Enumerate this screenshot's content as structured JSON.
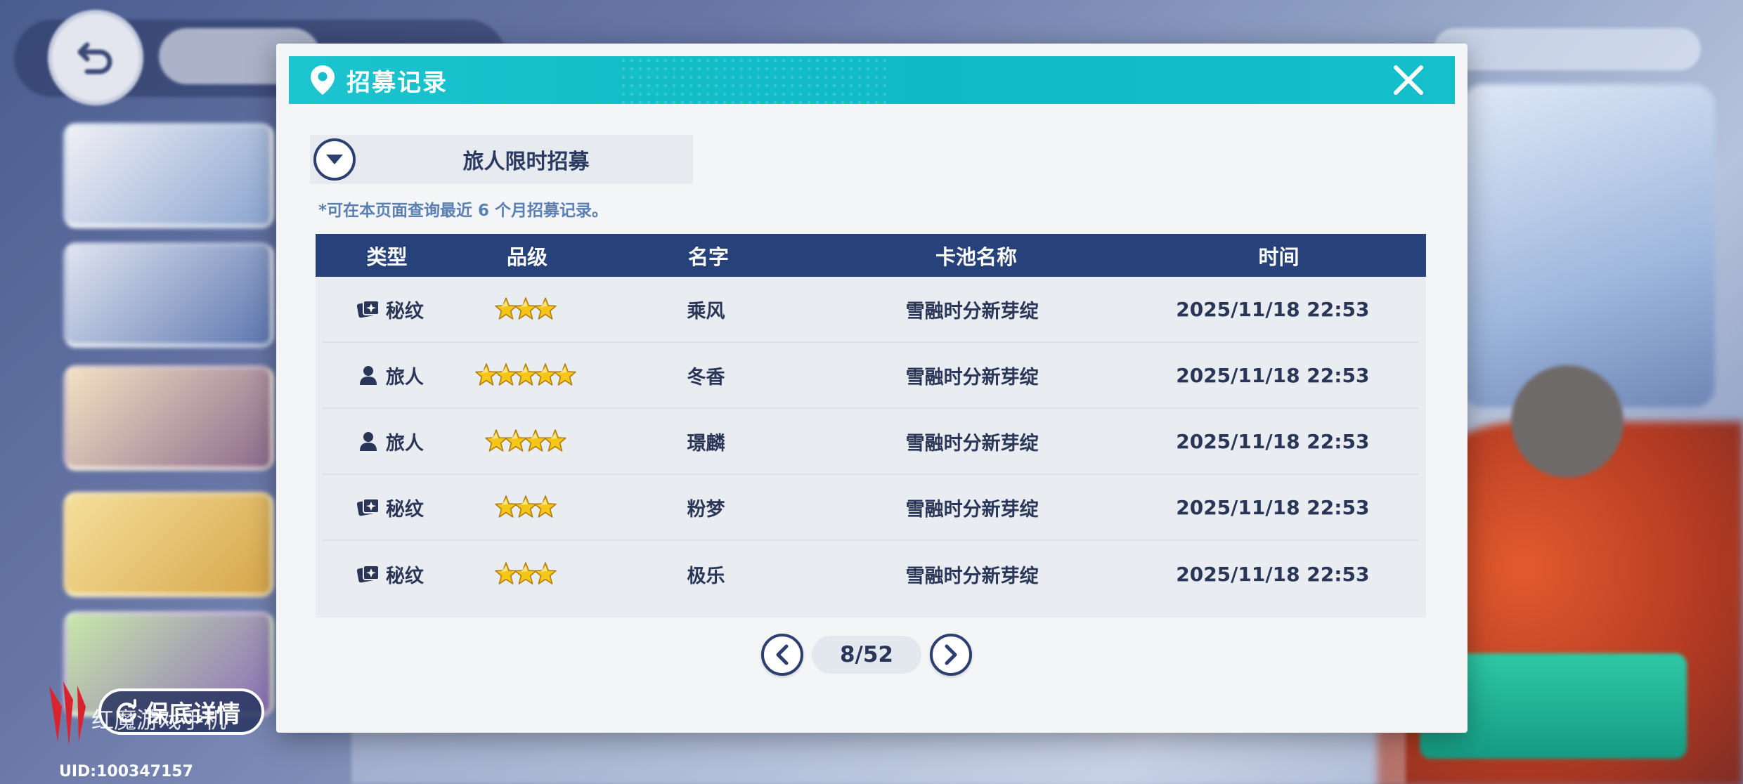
{
  "dialog": {
    "title": "招募记录",
    "pool_selector_label": "旅人限时招募",
    "notice": "*可在本页面查询最近 6 个月招募记录。"
  },
  "table": {
    "headers": {
      "type": "类型",
      "grade": "品级",
      "name": "名字",
      "pool": "卡池名称",
      "time": "时间"
    },
    "rows": [
      {
        "type": "秘纹",
        "type_icon": "card-icon",
        "stars": 3,
        "name": "乘风",
        "pool": "雪融时分新芽绽",
        "time": "2025/11/18 22:53"
      },
      {
        "type": "旅人",
        "type_icon": "person-icon",
        "stars": 5,
        "name": "冬香",
        "pool": "雪融时分新芽绽",
        "time": "2025/11/18 22:53"
      },
      {
        "type": "旅人",
        "type_icon": "person-icon",
        "stars": 4,
        "name": "璟麟",
        "pool": "雪融时分新芽绽",
        "time": "2025/11/18 22:53"
      },
      {
        "type": "秘纹",
        "type_icon": "card-icon",
        "stars": 3,
        "name": "粉梦",
        "pool": "雪融时分新芽绽",
        "time": "2025/11/18 22:53"
      },
      {
        "type": "秘纹",
        "type_icon": "card-icon",
        "stars": 3,
        "name": "极乐",
        "pool": "雪融时分新芽绽",
        "time": "2025/11/18 22:53"
      }
    ]
  },
  "pager": {
    "page_text": "8/52"
  },
  "overlay": {
    "support_label": "保底详情",
    "watermark": "红魔游戏手机",
    "uid": "UID:100347157"
  },
  "colors": {
    "header_teal": "#13bec9",
    "table_head_navy": "#27417a",
    "star_gold": "#f5c518"
  }
}
